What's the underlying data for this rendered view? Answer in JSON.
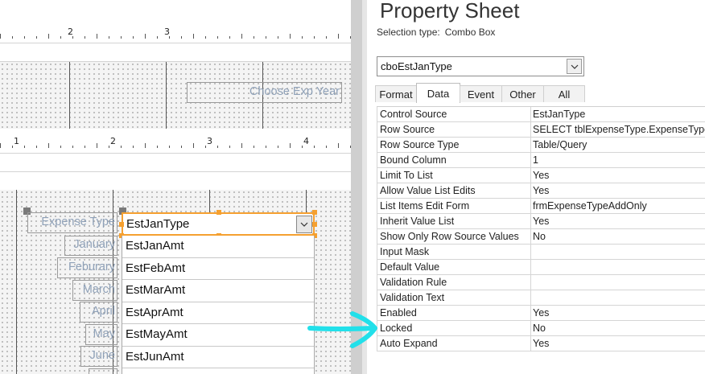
{
  "designer": {
    "ruler_top_numbers": [
      "2",
      "3"
    ],
    "ruler_mid_numbers": [
      "1",
      "2",
      "3",
      "4"
    ],
    "header_label": "Choose Exp Year",
    "labels": [
      "Expense Type",
      "January",
      "Feburary",
      "March",
      "April",
      "May",
      "June"
    ],
    "combo_value": "EstJanType",
    "dropdown_items": [
      "EstJanAmt",
      "EstFebAmt",
      "EstMarAmt",
      "EstAprAmt",
      "EstMayAmt",
      "EstJunAmt"
    ]
  },
  "sheet": {
    "title": "Property Sheet",
    "selection_label": "Selection type:",
    "selection_value": "Combo Box",
    "object_name": "cboEstJanType",
    "tabs": [
      "Format",
      "Data",
      "Event",
      "Other",
      "All"
    ],
    "active_tab": "Data",
    "properties": [
      {
        "name": "Control Source",
        "value": "EstJanType"
      },
      {
        "name": "Row Source",
        "value": "SELECT tblExpenseType.ExpenseType"
      },
      {
        "name": "Row Source Type",
        "value": "Table/Query"
      },
      {
        "name": "Bound Column",
        "value": "1"
      },
      {
        "name": "Limit To List",
        "value": "Yes"
      },
      {
        "name": "Allow Value List Edits",
        "value": "Yes"
      },
      {
        "name": "List Items Edit Form",
        "value": "frmExpenseTypeAddOnly"
      },
      {
        "name": "Inherit Value List",
        "value": "Yes"
      },
      {
        "name": "Show Only Row Source Values",
        "value": "No"
      },
      {
        "name": "Input Mask",
        "value": ""
      },
      {
        "name": "Default Value",
        "value": ""
      },
      {
        "name": "Validation Rule",
        "value": ""
      },
      {
        "name": "Validation Text",
        "value": ""
      },
      {
        "name": "Enabled",
        "value": "Yes"
      },
      {
        "name": "Locked",
        "value": "No"
      },
      {
        "name": "Auto Expand",
        "value": "Yes"
      }
    ]
  },
  "colors": {
    "selection_outline": "#f5a030",
    "annotation_arrow": "#22e0ea",
    "ghost_label_text": "#8fa1b8"
  }
}
